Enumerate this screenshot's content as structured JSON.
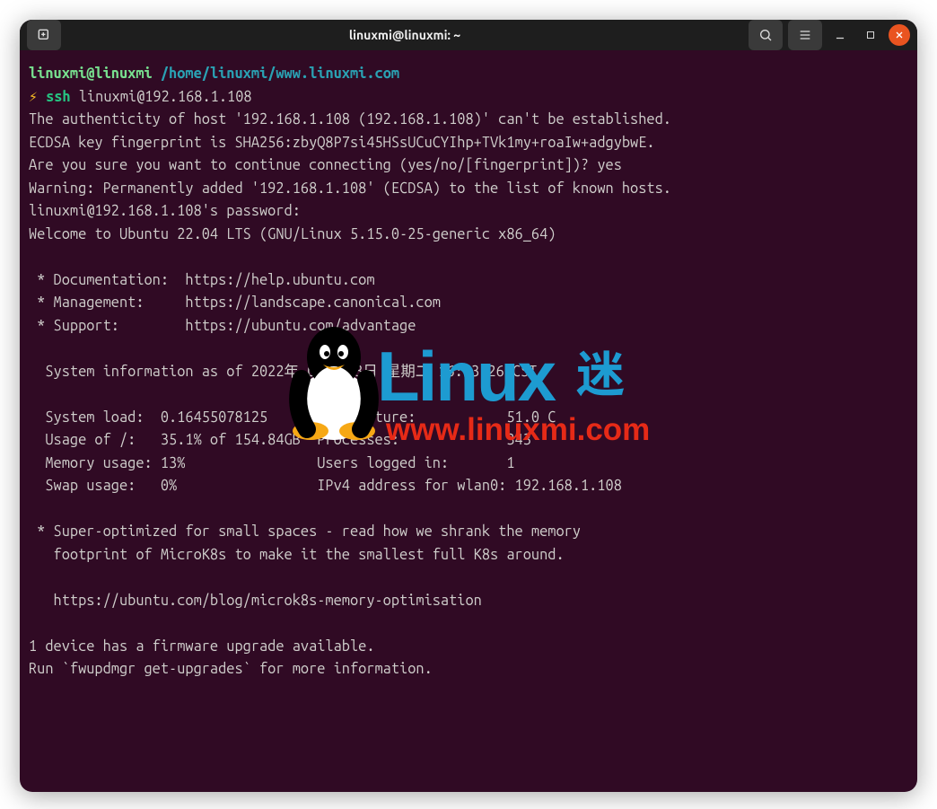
{
  "window": {
    "title": "linuxmi@linuxmi: ~"
  },
  "prompt": {
    "user_host": "linuxmi@linuxmi",
    "path": "/home/linuxmi/www.linuxmi.com",
    "bolt": "⚡",
    "cmd": "ssh",
    "args": "linuxmi@192.168.1.108"
  },
  "lines": {
    "l1": "The authenticity of host '192.168.1.108 (192.168.1.108)' can't be established.",
    "l2": "ECDSA key fingerprint is SHA256:zbyQ8P7si45HSsUCuCYIhp+TVk1my+roaIw+adgybwE.",
    "l3": "Are you sure you want to continue connecting (yes/no/[fingerprint])? yes",
    "l4": "Warning: Permanently added '192.168.1.108' (ECDSA) to the list of known hosts.",
    "l5": "linuxmi@192.168.1.108's password:",
    "l6": "Welcome to Ubuntu 22.04 LTS (GNU/Linux 5.15.0-25-generic x86_64)",
    "blank": " ",
    "doc": " * Documentation:  https://help.ubuntu.com",
    "mgmt": " * Management:     https://landscape.canonical.com",
    "support": " * Support:        https://ubuntu.com/advantage",
    "sysinfo_hdr": "  System information as of 2022年 08月 23日 星期二 16:53:26 CST",
    "row1": "  System load:  0.16455078125      Temperature:           51.0 C",
    "row2": "  Usage of /:   35.1% of 154.84GB  Processes:             343",
    "row3": "  Memory usage: 13%                Users logged in:       1",
    "row4": "  Swap usage:   0%                 IPv4 address for wlan0: 192.168.1.108",
    "sup1": " * Super-optimized for small spaces - read how we shrank the memory",
    "sup2": "   footprint of MicroK8s to make it the smallest full K8s around.",
    "sup3": "   https://ubuntu.com/blog/microk8s-memory-optimisation",
    "fw1": "1 device has a firmware upgrade available.",
    "fw2": "Run `fwupdmgr get-upgrades` for more information."
  },
  "watermark": {
    "brand": "Linux",
    "suffix": "迷",
    "url": "www.linuxmi.com"
  }
}
